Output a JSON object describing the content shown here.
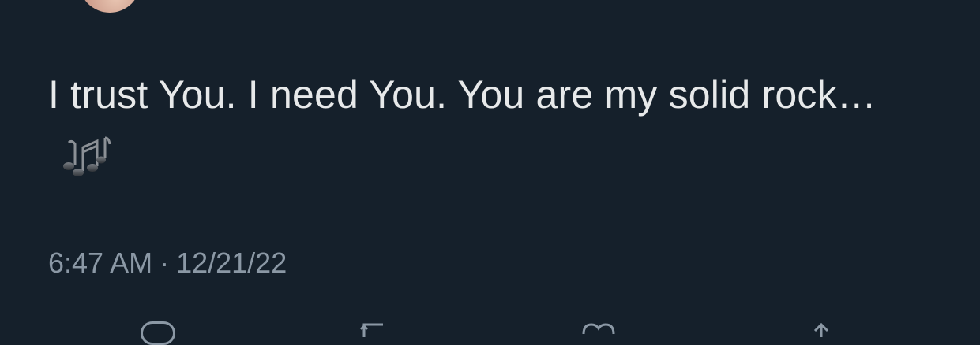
{
  "tweet": {
    "text": "I trust You. I need You. You are my solid rock…",
    "emoji_icon": "musical-notes-icon",
    "time": "6:47 AM",
    "separator": "·",
    "date": "12/21/22"
  },
  "actions": {
    "icons": [
      "reply-icon",
      "retweet-icon",
      "like-icon",
      "share-icon"
    ]
  },
  "colors": {
    "background": "#15202b",
    "text": "#e7e9ea",
    "secondary_text": "#8b98a5"
  }
}
